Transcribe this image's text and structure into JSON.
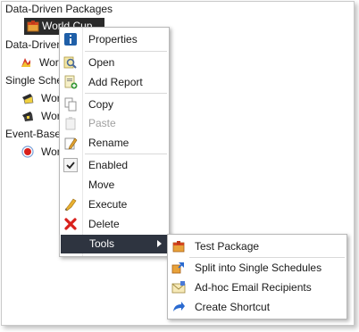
{
  "tree": {
    "group1_label": "Data-Driven Packages",
    "item1_label": "World Cup",
    "group2_label": "Data-Driven",
    "item2_label": "Wor",
    "group3_label": "Single Schedu",
    "item3_label": "Wor",
    "item4_label": "Wor",
    "group4_label": "Event-Based",
    "item5_label": "Wor"
  },
  "context_menu": {
    "properties": "Properties",
    "open": "Open",
    "add_report": "Add Report",
    "copy": "Copy",
    "paste": "Paste",
    "rename": "Rename",
    "enabled": "Enabled",
    "move": "Move",
    "execute": "Execute",
    "delete": "Delete",
    "tools": "Tools"
  },
  "tools_submenu": {
    "test_package": "Test Package",
    "split": "Split into Single Schedules",
    "adhoc_email": "Ad-hoc Email Recipients",
    "create_shortcut": "Create Shortcut"
  },
  "colors": {
    "selection_bg": "#2b2b2b",
    "tools_highlight_bg": "#2e3440",
    "delete_red": "#d9201c",
    "info_blue": "#1f5fa8"
  },
  "icons": {
    "properties": "info-icon",
    "open": "magnifier-icon",
    "add_report": "add-report-icon",
    "copy": "copy-icon",
    "paste": "paste-icon",
    "rename": "rename-icon",
    "enabled": "checkmark-icon",
    "execute": "execute-icon",
    "delete": "delete-x-icon",
    "tools": "submenu-arrow-icon",
    "test_package": "package-icon",
    "split": "split-icon",
    "adhoc_email": "email-icon",
    "create_shortcut": "shortcut-icon"
  }
}
